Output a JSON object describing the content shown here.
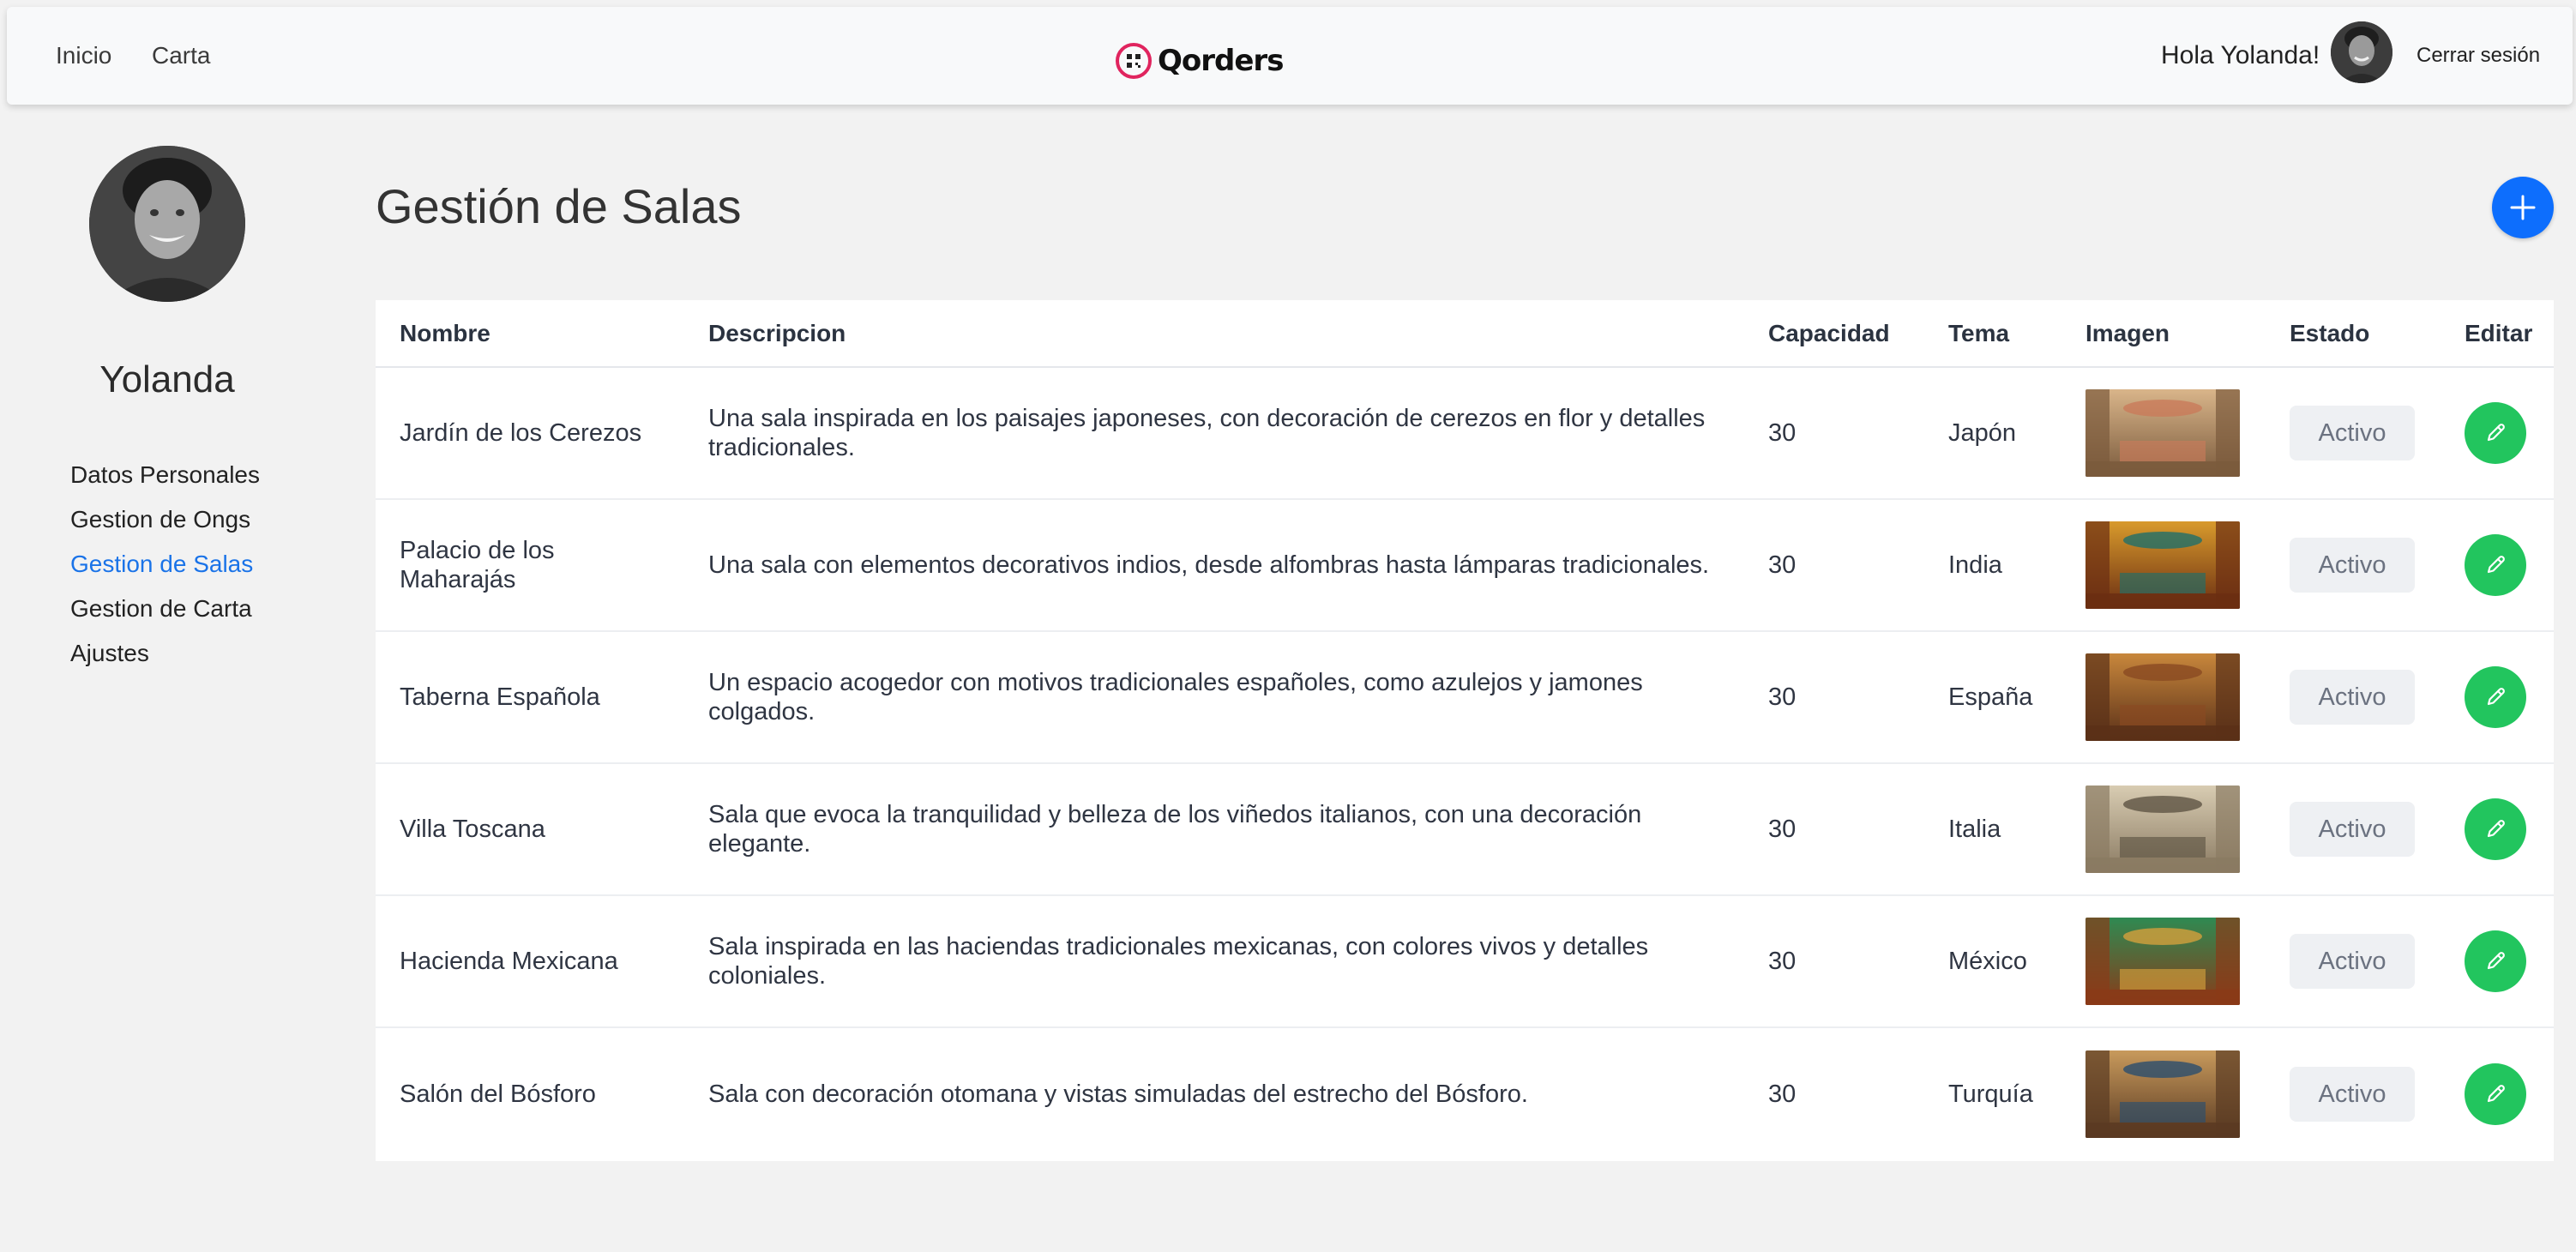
{
  "navbar": {
    "links": [
      "Inicio",
      "Carta"
    ],
    "brand": "Qorders",
    "greeting": "Hola Yolanda!",
    "logout_label": "Cerrar sesión"
  },
  "sidebar": {
    "user_name": "Yolanda",
    "items": [
      {
        "label": "Datos Personales",
        "active": false
      },
      {
        "label": "Gestion de Ongs",
        "active": false
      },
      {
        "label": "Gestion de Salas",
        "active": true
      },
      {
        "label": "Gestion de Carta",
        "active": false
      },
      {
        "label": "Ajustes",
        "active": false
      }
    ]
  },
  "main": {
    "title": "Gestión de Salas",
    "add_icon": "plus-icon",
    "table": {
      "headers": [
        "Nombre",
        "Descripcion",
        "Capacidad",
        "Tema",
        "Imagen",
        "Estado",
        "Editar"
      ],
      "rows": [
        {
          "nombre": "Jardín de los Cerezos",
          "descripcion": "Una sala inspirada en los paisajes japoneses, con decoración de cerezos en flor y detalles tradicionales.",
          "capacidad": "30",
          "tema": "Japón",
          "estado": "Activo",
          "image_colors": [
            "#7a5a3c",
            "#d9b58a",
            "#c97b5a"
          ]
        },
        {
          "nombre": "Palacio de los Maharajás",
          "descripcion": "Una sala con elementos decorativos indios, desde alfombras hasta lámparas tradicionales.",
          "capacidad": "30",
          "tema": "India",
          "estado": "Activo",
          "image_colors": [
            "#6b2e12",
            "#d89a2c",
            "#1f6f6a"
          ]
        },
        {
          "nombre": "Taberna Española",
          "descripcion": "Un espacio acogedor con motivos tradicionales españoles, como azulejos y jamones colgados.",
          "capacidad": "30",
          "tema": "España",
          "estado": "Activo",
          "image_colors": [
            "#5a3018",
            "#c8873c",
            "#8a4a22"
          ]
        },
        {
          "nombre": "Villa Toscana",
          "descripcion": "Sala que evoca la tranquilidad y belleza de los viñedos italianos, con una decoración elegante.",
          "capacidad": "30",
          "tema": "Italia",
          "estado": "Activo",
          "image_colors": [
            "#8a7a62",
            "#d8ccb2",
            "#5e5444"
          ]
        },
        {
          "nombre": "Hacienda Mexicana",
          "descripcion": "Sala inspirada en las haciendas tradicionales mexicanas, con colores vivos y detalles coloniales.",
          "capacidad": "30",
          "tema": "México",
          "estado": "Activo",
          "image_colors": [
            "#8a3a18",
            "#2f8a52",
            "#d4a03c"
          ]
        },
        {
          "nombre": "Salón del Bósforo",
          "descripcion": "Sala con decoración otomana y vistas simuladas del estrecho del Bósforo.",
          "capacidad": "30",
          "tema": "Turquía",
          "estado": "Activo",
          "image_colors": [
            "#5a3a22",
            "#c89a5c",
            "#2a4e6e"
          ]
        }
      ]
    }
  },
  "colors": {
    "accent": "#0d6efd",
    "active_link": "#1a73e8",
    "edit_button": "#22c55e",
    "status_bg": "#eef0f3",
    "brand_red": "#e0245e"
  }
}
